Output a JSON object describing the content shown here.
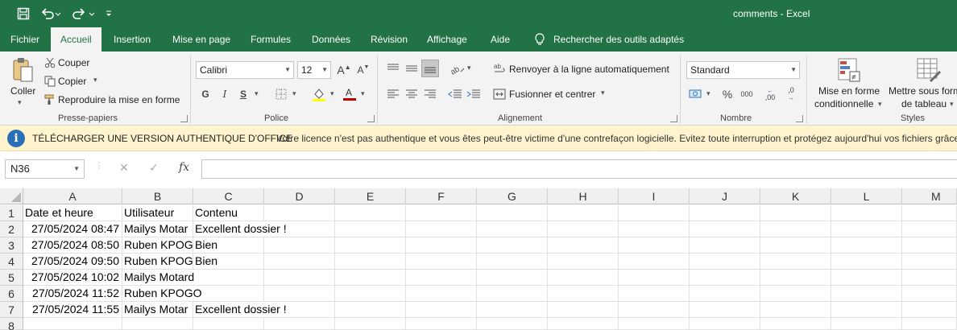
{
  "app": {
    "title": "comments  -  Excel"
  },
  "tabs": [
    "Fichier",
    "Accueil",
    "Insertion",
    "Mise en page",
    "Formules",
    "Données",
    "Révision",
    "Affichage",
    "Aide"
  ],
  "search": {
    "label": "Rechercher des outils adaptés",
    "icon": "lightbulb-icon"
  },
  "ribbon": {
    "clipboard": {
      "paste": "Coller",
      "cut": "Couper",
      "copy": "Copier",
      "format_painter": "Reproduire la mise en forme",
      "group": "Presse-papiers"
    },
    "font": {
      "name": "Calibri",
      "size": "12",
      "grow": "A",
      "shrink": "A",
      "bold": "G",
      "italic": "I",
      "underline": "S",
      "group": "Police",
      "fill_color": "#ffff00",
      "font_color": "#c00000"
    },
    "alignment": {
      "wrap": "Renvoyer à la ligne automatiquement",
      "merge": "Fusionner et centrer",
      "group": "Alignement"
    },
    "number": {
      "format": "Standard",
      "percent": "%",
      "thousands": "000",
      "inc_dec": ",00",
      "dec_dec": ",0",
      "group": "Nombre"
    },
    "styles": {
      "conditional_line1": "Mise en forme",
      "conditional_line2": "conditionnelle",
      "table_line1": "Mettre sous forme",
      "table_line2": "de tableau",
      "group": "Styles"
    }
  },
  "infobar": {
    "heading": "TÉLÉCHARGER UNE VERSION AUTHENTIQUE D'OFFICE",
    "message": "Votre licence n'est pas authentique et vous êtes peut-être victime d'une contrefaçon logicielle. Evitez toute interruption et protégez aujourd'hui vos fichiers grâce"
  },
  "formula_bar": {
    "name_box": "N36",
    "fx": "fx",
    "formula": ""
  },
  "sheet": {
    "columns": [
      "A",
      "B",
      "C",
      "D",
      "E",
      "F",
      "G",
      "H",
      "I",
      "J",
      "K",
      "L",
      "M"
    ],
    "row_numbers": [
      "1",
      "2",
      "3",
      "4",
      "5",
      "6",
      "7",
      "8"
    ],
    "header": [
      "Date et heure",
      "Utilisateur",
      "Contenu"
    ],
    "rows": [
      [
        "27/05/2024 08:47",
        "Mailys Motar",
        "Excellent dossier !"
      ],
      [
        "27/05/2024 08:50",
        "Ruben KPOG(",
        "Bien"
      ],
      [
        "27/05/2024 09:50",
        "Ruben KPOG(",
        "Bien"
      ],
      [
        "27/05/2024 10:02",
        "Mailys Motard",
        ""
      ],
      [
        "27/05/2024 11:52",
        "Ruben KPOGO",
        ""
      ],
      [
        "27/05/2024 11:55",
        "Mailys Motar",
        "Excellent dossier !"
      ]
    ]
  }
}
